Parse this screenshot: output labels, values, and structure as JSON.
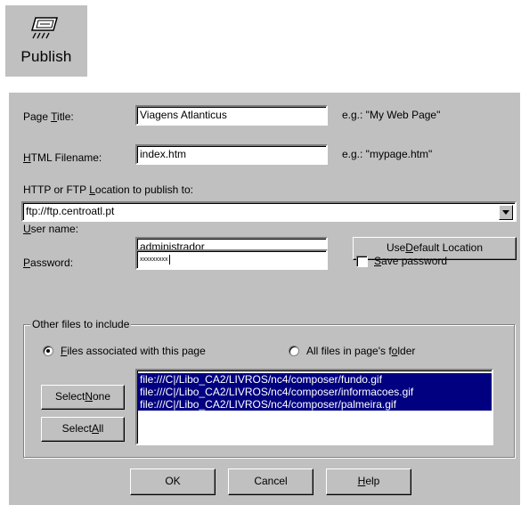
{
  "toolbar": {
    "publish_label": "Publish",
    "publish_icon": "publish-icon"
  },
  "dialog": {
    "page_title": {
      "label_pre": "Page ",
      "label_key": "T",
      "label_post": "itle:",
      "value": "Viagens Atlanticus",
      "hint": "e.g.: \"My Web Page\""
    },
    "html_filename": {
      "label_key": "H",
      "label_post": "TML Filename:",
      "value": "index.htm",
      "hint": "e.g.: \"mypage.htm\""
    },
    "location": {
      "label_pre": "HTTP or FTP ",
      "label_key": "L",
      "label_post": "ocation to publish to:",
      "value": "ftp://ftp.centroatl.pt",
      "dropdown_icon": "chevron-down-icon"
    },
    "user_name": {
      "label_key": "U",
      "label_post": "ser name:",
      "value": "administrador"
    },
    "password": {
      "label_key": "P",
      "label_post": "assword:",
      "value": "xxxxxxxxx"
    },
    "use_default_location": {
      "pre": "Use ",
      "key": "D",
      "post": "efault Location"
    },
    "save_password": {
      "key": "S",
      "post": "ave password",
      "checked": false
    },
    "other_files": {
      "title": "Other files to include",
      "radio_associated": {
        "key": "F",
        "post": "iles associated with this page",
        "selected": true
      },
      "radio_all": {
        "pre": "All files in page's f",
        "key": "o",
        "post": "lder",
        "selected": false
      },
      "select_none": {
        "pre": "Select ",
        "key": "N",
        "post": "one"
      },
      "select_all": {
        "pre": "Select ",
        "key": "A",
        "post": "ll"
      },
      "files": [
        "file:///C|/Libo_CA2/LIVROS/nc4/composer/fundo.gif",
        "file:///C|/Libo_CA2/LIVROS/nc4/composer/informacoes.gif",
        "file:///C|/Libo_CA2/LIVROS/nc4/composer/palmeira.gif"
      ]
    },
    "buttons": {
      "ok": "OK",
      "cancel": "Cancel",
      "help_key": "H",
      "help_post": "elp"
    }
  },
  "colors": {
    "dialog_bg": "#c0c0c0",
    "selection_bg": "#000080",
    "selection_fg": "#ffffff"
  }
}
